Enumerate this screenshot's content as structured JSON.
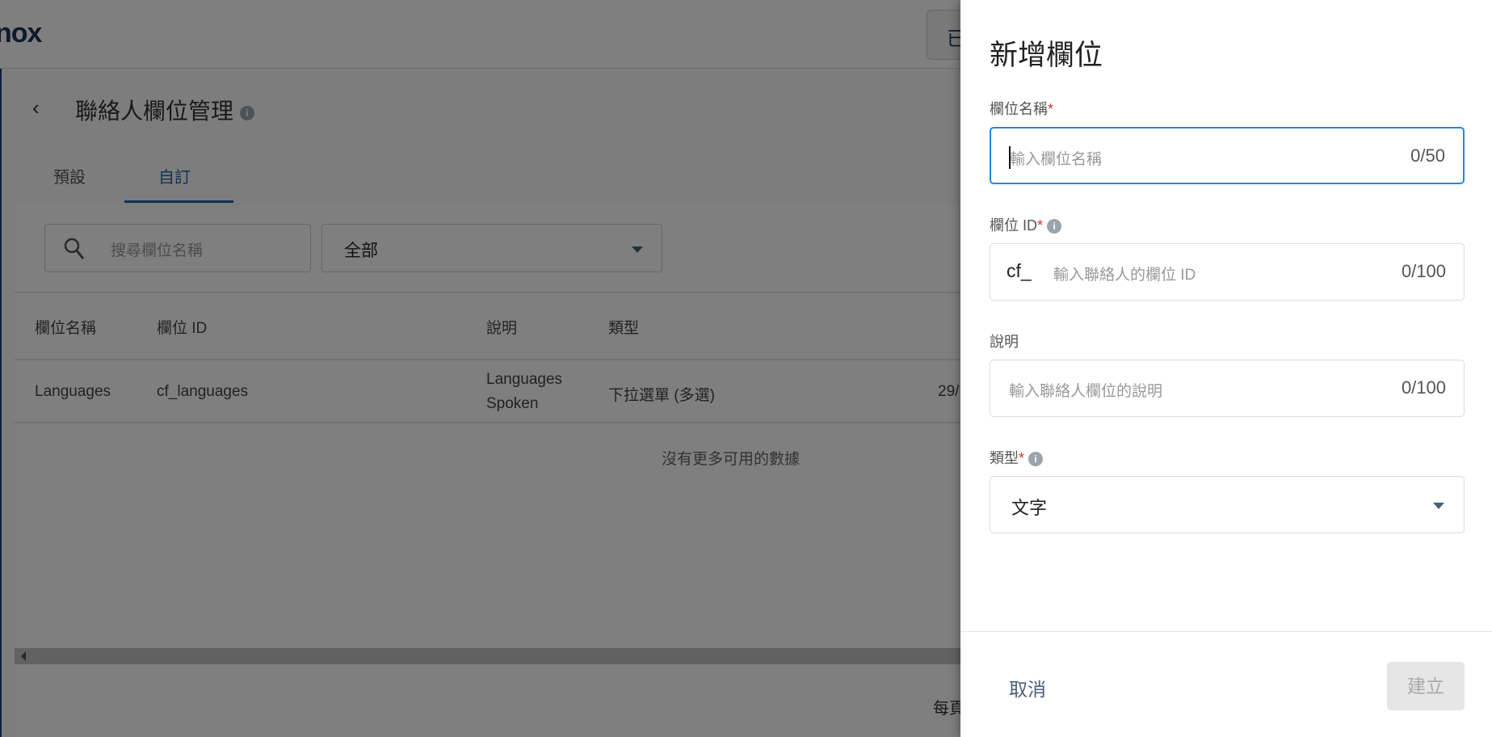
{
  "header": {
    "logo": "nox",
    "logo_accent": "x",
    "partial_button": "已"
  },
  "page": {
    "title": "聯絡人欄位管理",
    "tabs": [
      {
        "label": "預設",
        "active": false
      },
      {
        "label": "自訂",
        "active": true
      }
    ]
  },
  "filters": {
    "search_placeholder": "搜尋欄位名稱",
    "type_select": "全部"
  },
  "table": {
    "columns": [
      "欄位名稱",
      "欄位 ID",
      "說明",
      "類型"
    ],
    "rows": [
      {
        "name": "Languages",
        "id": "cf_languages",
        "desc_line1": "Languages",
        "desc_line2": "Spoken",
        "type": "下拉選單 (多選)",
        "extra": "29/"
      }
    ],
    "empty_text": "沒有更多可用的數據"
  },
  "pager": {
    "label": "每頁"
  },
  "drawer": {
    "title": "新增欄位",
    "name_field": {
      "label": "欄位名稱",
      "required": "*",
      "placeholder": "輸入欄位名稱",
      "counter": "0/50"
    },
    "id_field": {
      "label": "欄位 ID",
      "required": "*",
      "prefix": "cf_",
      "placeholder": "輸入聯絡人的欄位 ID",
      "counter": "0/100"
    },
    "desc_field": {
      "label": "說明",
      "placeholder": "輸入聯絡人欄位的說明",
      "counter": "0/100"
    },
    "type_field": {
      "label": "類型",
      "required": "*",
      "value": "文字"
    },
    "cancel": "取消",
    "create": "建立"
  },
  "colors": {
    "accent": "#1e88e5",
    "tab_active": "#1e63a8",
    "required": "#d32f2f"
  }
}
